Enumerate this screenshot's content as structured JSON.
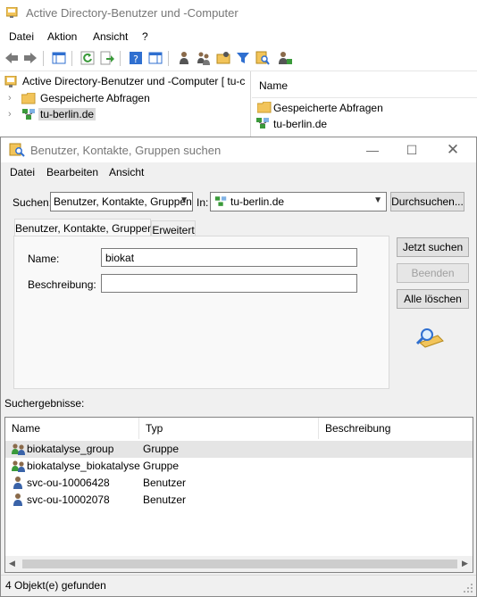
{
  "main": {
    "title": "Active Directory-Benutzer und -Computer",
    "menu": [
      "Datei",
      "Aktion",
      "Ansicht",
      "?"
    ],
    "tree": {
      "root": "Active Directory-Benutzer und -Computer [ tu-c",
      "items": [
        "Gespeicherte Abfragen",
        "tu-berlin.de"
      ]
    },
    "right_pane": {
      "header": "Name",
      "items": [
        "Gespeicherte Abfragen",
        "tu-berlin.de"
      ]
    }
  },
  "dialog": {
    "title": "Benutzer, Kontakte, Gruppen suchen",
    "menu": [
      "Datei",
      "Bearbeiten",
      "Ansicht"
    ],
    "suchen_label": "Suchen:",
    "suchen_value": "Benutzer, Kontakte, Gruppen",
    "in_label": "In:",
    "in_value": "tu-berlin.de",
    "browse_button": "Durchsuchen...",
    "tabs": [
      "Benutzer, Kontakte, Gruppen",
      "Erweitert"
    ],
    "name_label": "Name:",
    "name_value": "biokat",
    "desc_label": "Beschreibung:",
    "desc_value": "",
    "buttons": {
      "search_now": "Jetzt suchen",
      "stop": "Beenden",
      "clear_all": "Alle löschen"
    },
    "results_label": "Suchergebnisse:",
    "columns": [
      "Name",
      "Typ",
      "Beschreibung"
    ],
    "rows": [
      {
        "name": "biokatalyse_group",
        "type": "Gruppe",
        "icon": "group-icon"
      },
      {
        "name": "biokatalyse_biokatalyse",
        "type": "Gruppe",
        "icon": "group-icon"
      },
      {
        "name": "svc-ou-10006428",
        "type": "Benutzer",
        "icon": "user-icon"
      },
      {
        "name": "svc-ou-10002078",
        "type": "Benutzer",
        "icon": "user-icon"
      }
    ],
    "status": "4 Objekt(e) gefunden"
  },
  "colors": {
    "folder": "#f2c45a",
    "toolbar_blue": "#2f6fd0",
    "user_blue": "#3a63a8",
    "green": "#3a9a3a"
  }
}
